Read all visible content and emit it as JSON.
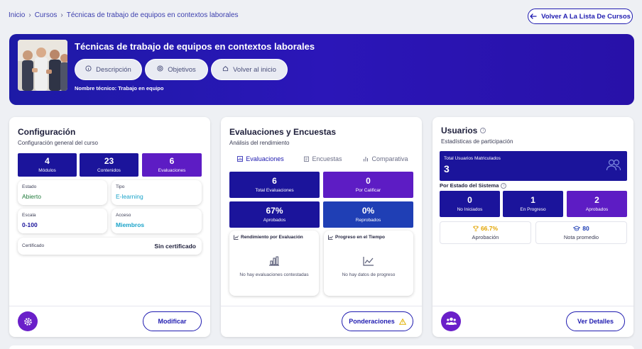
{
  "breadcrumb": {
    "home": "Inicio",
    "courses": "Cursos",
    "current": "Técnicas de trabajo de equipos en contextos laborales"
  },
  "back_button": "Volver A La Lista De Cursos",
  "hero": {
    "title": "Técnicas de trabajo de equipos en contextos laborales",
    "pills": [
      "Descripción",
      "Objetivos",
      "Volver al inicio"
    ],
    "tech_name": "Nombre técnico: Trabajo en equipo"
  },
  "config": {
    "title": "Configuración",
    "subtitle": "Configuración general del curso",
    "stats": [
      {
        "value": "4",
        "label": "Módulos"
      },
      {
        "value": "23",
        "label": "Contenidos"
      },
      {
        "value": "6",
        "label": "Evaluaciones"
      }
    ],
    "fields": {
      "estado_label": "Estado",
      "estado_value": "Abierto",
      "tipo_label": "Tipo",
      "tipo_value": "E-learning",
      "escala_label": "Escala",
      "escala_value": "0-100",
      "acceso_label": "Acceso",
      "acceso_value": "Miembros",
      "cert_label": "Certificado",
      "cert_value": "Sin certificado"
    },
    "button": "Modificar"
  },
  "evals": {
    "title": "Evaluaciones y Encuestas",
    "subtitle": "Análisis del rendimiento",
    "tabs": [
      "Evaluaciones",
      "Encuestas",
      "Comparativa"
    ],
    "stats": [
      {
        "value": "6",
        "label": "Total Evaluaciones"
      },
      {
        "value": "0",
        "label": "Por Calificar"
      },
      {
        "value": "67%",
        "label": "Aprobados"
      },
      {
        "value": "0%",
        "label": "Reprobados"
      }
    ],
    "panel1_title": "Rendimiento por Evaluación",
    "panel1_empty": "No hay evaluaciones contestadas",
    "panel2_title": "Progreso en el Tiempo",
    "panel2_empty": "No hay datos de progreso",
    "button": "Ponderaciones"
  },
  "users": {
    "title": "Usuarios",
    "subtitle": "Estadísticas de participación",
    "total_label": "Total Usuarios Matriculados",
    "total_value": "3",
    "by_state": "Por Estado del Sistema",
    "states": [
      {
        "value": "0",
        "label": "No Iniciados"
      },
      {
        "value": "1",
        "label": "En Progreso"
      },
      {
        "value": "2",
        "label": "Aprobados"
      }
    ],
    "approval_value": "66.7%",
    "approval_label": "Aprobación",
    "grade_value": "80",
    "grade_label": "Nota promedio",
    "button": "Ver Detalles"
  },
  "colors": {
    "navy": "#1b149b",
    "purple": "#5d1cc4",
    "royal": "#1f3fb5",
    "accent": "#1f1bb0",
    "green": "#1f7a3a",
    "cyan": "#1aa3c9"
  }
}
